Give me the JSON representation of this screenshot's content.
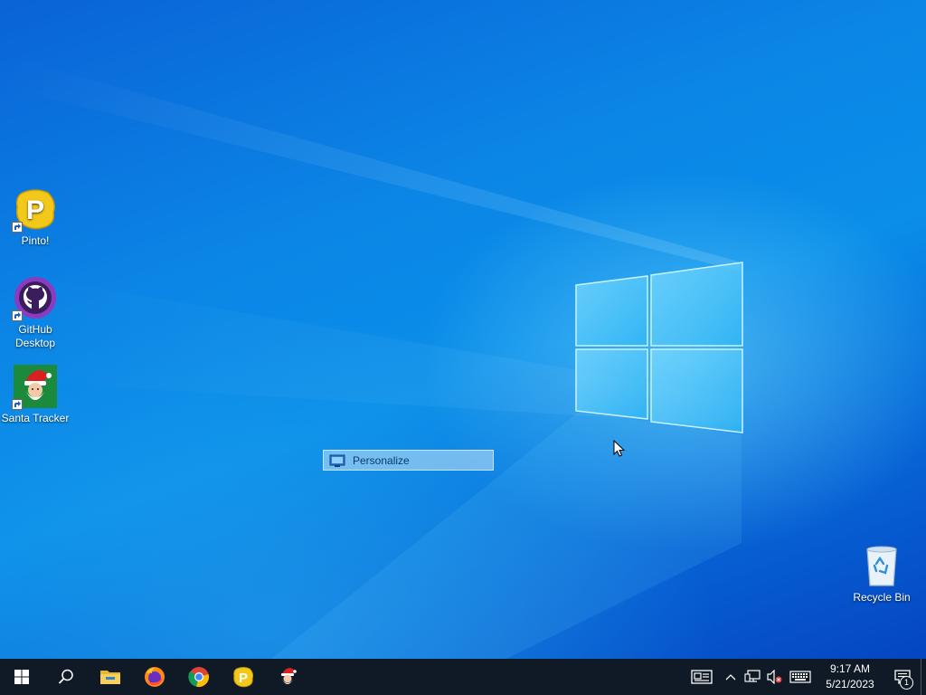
{
  "desktop": {
    "icons": [
      {
        "label": "Pinto!",
        "icon": "pinto-icon"
      },
      {
        "label": "GitHub Desktop",
        "icon": "github-desktop-icon"
      },
      {
        "label": "Santa Tracker",
        "icon": "santa-tracker-icon"
      },
      {
        "label": "Recycle Bin",
        "icon": "recycle-bin-icon"
      }
    ],
    "drag_ghost": {
      "label": "Personalize",
      "icon": "personalize-icon"
    }
  },
  "taskbar": {
    "pinned": [
      {
        "name": "File Explorer",
        "icon": "file-explorer-icon"
      },
      {
        "name": "Firefox",
        "icon": "firefox-icon"
      },
      {
        "name": "Google Chrome",
        "icon": "chrome-icon"
      },
      {
        "name": "Pinto!",
        "icon": "pinto-icon"
      },
      {
        "name": "Santa Tracker",
        "icon": "santa-tracker-icon"
      }
    ],
    "clock": {
      "time": "9:17 AM",
      "date": "5/21/2023"
    },
    "notifications": {
      "count": "1"
    }
  },
  "colors": {
    "desktop": "#0a80e4",
    "taskbar": "#101a26",
    "accent": "#0078d7"
  }
}
